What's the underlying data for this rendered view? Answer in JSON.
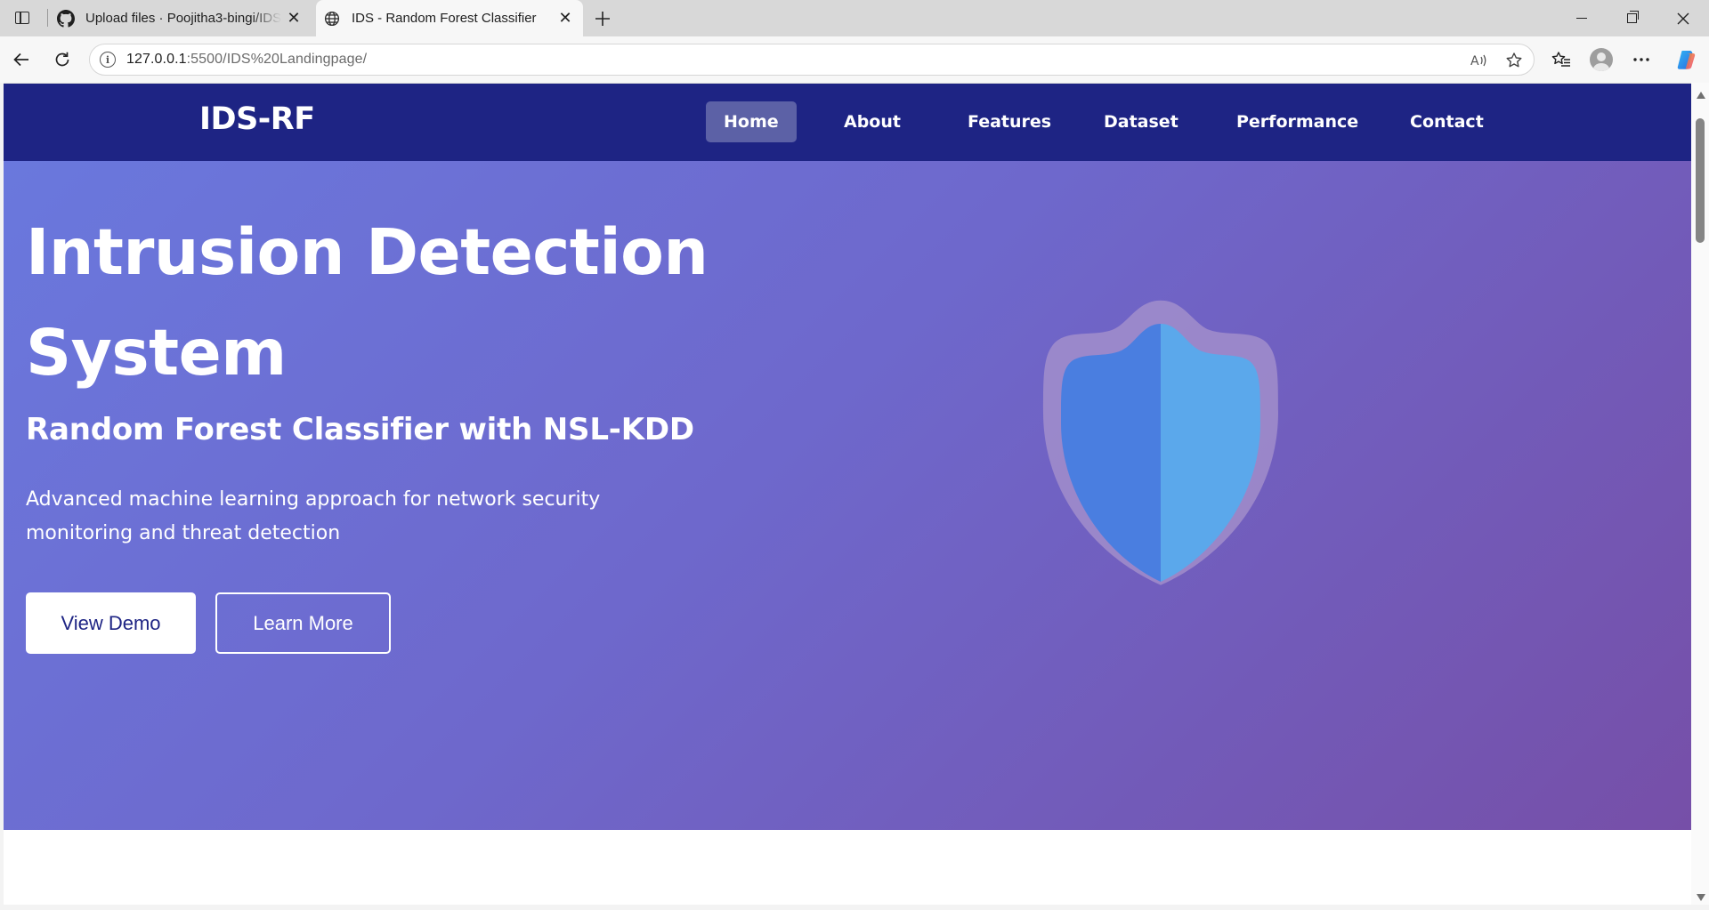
{
  "browser": {
    "tabs": [
      {
        "title": "Upload files · Poojitha3-bingi/IDS",
        "favicon": "github-icon"
      },
      {
        "title": "IDS - Random Forest Classifier",
        "favicon": "globe-icon"
      }
    ],
    "address": {
      "host": "127.0.0.1",
      "path": ":5500/IDS%20Landingpage/"
    }
  },
  "site": {
    "brand": "IDS-RF",
    "nav": [
      {
        "label": "Home",
        "active": true
      },
      {
        "label": "About"
      },
      {
        "label": "Features"
      },
      {
        "label": "Dataset"
      },
      {
        "label": "Performance"
      },
      {
        "label": "Contact"
      }
    ]
  },
  "hero": {
    "title_line1": "Intrusion Detection",
    "title_line2": "System",
    "subtitle": "Random Forest Classifier with NSL-KDD",
    "description": "Advanced machine learning approach for network security monitoring and threat detection",
    "buttons": {
      "demo": "View Demo",
      "learn": "Learn More"
    },
    "icon": "shield-icon"
  },
  "colors": {
    "nav_bg": "#1e2484",
    "hero_gradient_start": "#6a78dd",
    "hero_gradient_end": "#764fa8",
    "shield_left": "#4a7ee0",
    "shield_right": "#5ba8eb"
  }
}
